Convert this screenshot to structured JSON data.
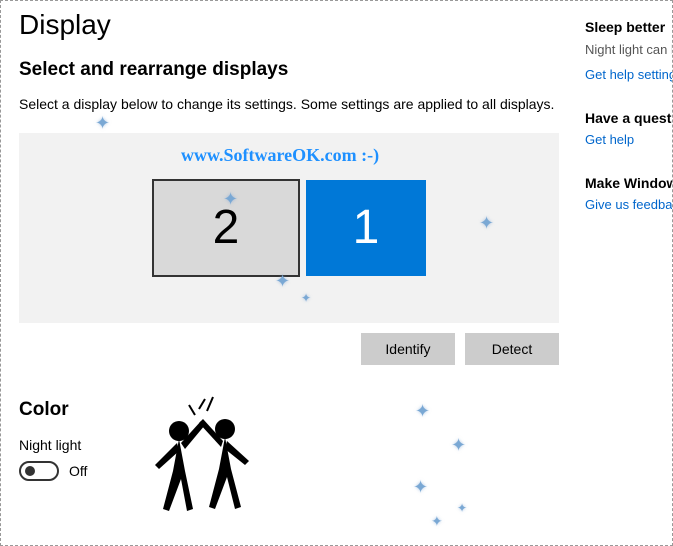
{
  "page": {
    "title": "Display",
    "section_title": "Select and rearrange displays",
    "description": "Select a display below to change its settings. Some settings are applied to all displays."
  },
  "monitors": {
    "primary": "1",
    "secondary": "2"
  },
  "buttons": {
    "identify": "Identify",
    "detect": "Detect"
  },
  "color": {
    "title": "Color",
    "night_light_label": "Night light",
    "night_light_state": "Off"
  },
  "sidebar": {
    "sleep": {
      "title": "Sleep better",
      "text": "Night light can help you get to sleep by displaying warmer colors at night. Select Night light settings to set things up.",
      "link": "Get help setting up"
    },
    "question": {
      "title": "Have a question?",
      "link": "Get help"
    },
    "feedback": {
      "title": "Make Windows better",
      "link": "Give us feedback"
    }
  },
  "watermark": "www.SoftwareOK.com :-)"
}
